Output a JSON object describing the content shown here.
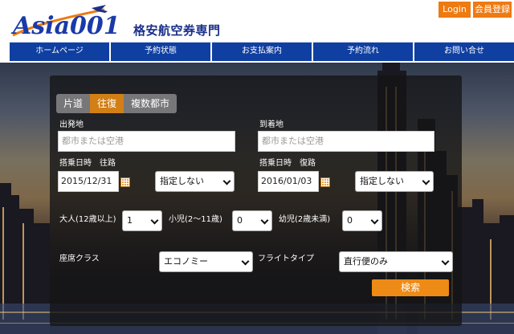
{
  "header": {
    "logo_text": "Asia001",
    "tagline": "格安航空券専門",
    "login_label": "Login",
    "register_label": "会員登録"
  },
  "nav": {
    "items": [
      "ホームページ",
      "予約状態",
      "お支払案内",
      "予約流れ",
      "お問い合せ"
    ]
  },
  "form": {
    "tabs": [
      {
        "label": "片道",
        "active": false
      },
      {
        "label": "往復",
        "active": true
      },
      {
        "label": "複数都市",
        "active": false
      }
    ],
    "origin": {
      "label": "出発地",
      "placeholder": "都市または空港"
    },
    "destination": {
      "label": "到着地",
      "placeholder": "都市または空港"
    },
    "outbound": {
      "label": "搭乗日時　往路",
      "date": "2015/12/31",
      "time": "指定しない"
    },
    "return": {
      "label": "搭乗日時　復路",
      "date": "2016/01/03",
      "time": "指定しない"
    },
    "adults": {
      "label": "大人(12歳以上)",
      "value": "1"
    },
    "children": {
      "label": "小児(2〜11歳)",
      "value": "0"
    },
    "infants": {
      "label": "幼児(2歳未満)",
      "value": "0"
    },
    "cabin": {
      "label": "座席クラス",
      "value": "エコノミー"
    },
    "flight_type": {
      "label": "フライトタイプ",
      "value": "直行便のみ"
    },
    "search_label": "検索"
  },
  "colors": {
    "accent": "#ee7a12",
    "nav": "#0f3fa1",
    "brand": "#1a2f8a"
  },
  "icons": {
    "calendar": "calendar-icon",
    "dropdown": "chevron-down-icon"
  }
}
